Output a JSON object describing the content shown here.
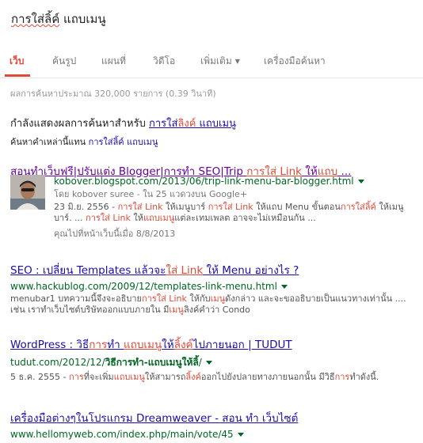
{
  "search": {
    "query_prefix": "การใส่",
    "query_misspelled": "ลิ้ค์",
    "query_suffix": " แถบเมนู"
  },
  "tabs": {
    "web": "เว็บ",
    "images": "ค้นรูป",
    "maps": "แผนที่",
    "videos": "วิดีโอ",
    "more": "เพิ่มเติม",
    "tools": "เครื่องมือค้นหา"
  },
  "stats": "ผลการค้นหาประมาณ 320,000 รายการ (0.39 วินาที)",
  "spelling": {
    "showing_label": "กำลังแสดงผลการค้นหาสำหรับ",
    "corrected_a": "การใส่",
    "corrected_b": "ลิงค์",
    "corrected_c": " แถบเมนู",
    "instead_label": "ค้นหาคำเหล่านี้แทน",
    "instead_query": "การใส่ลิ้ค์ แถบเมนู"
  },
  "results": [
    {
      "title_a": "สอนทำเว็บฟรี|ปรับแต่ง Blogger|การทำ SEO|Trip ",
      "title_em": "การใส่ Link",
      "title_b": " ให้",
      "title_em2": "แถบ",
      "title_c": " ...",
      "url": "kobover.blogspot.com/2013/06/trip-link-menu-bar-blogger.html",
      "author_meta": "โดย kobover suree - ใน 25 แวดวงบน Google+",
      "snippet_date": "23 มิ.ย. 2556 - ",
      "snippet_1": "การใส่ Link",
      "snippet_2": " ให้เมนูบาร์ ",
      "snippet_3": "การใส่ Link",
      "snippet_4": " ให้แถบ Menu ขั้นตอน",
      "snippet_5": "การใส่ลิ้ค์",
      "snippet_6": " ให้เมนูบาร์. ... ",
      "snippet_7": "การใส่ Link",
      "snippet_8": " ให้",
      "snippet_9": "แถบเมนู",
      "snippet_10": "แต่ละเทมเพลต อาจจะไม่เหมือนกัน ...",
      "visited": "คุณไปที่หน้าเว็บนี้เมื่อ 8/8/2013"
    },
    {
      "title_a": "SEO : เปลี่ยน Templates แล้วจะ",
      "title_em": "ใส่ Link",
      "title_b": " ให้ Menu อย่างไร ?",
      "url": "www.hackublog.com/2009/12/templates-link-menu.html",
      "snippet_1": "menubar1 บทความนี้จึงจะอธิบาย",
      "snippet_em1": "การใส่ Link",
      "snippet_2": " ให้กับ",
      "snippet_em2": "เมนู",
      "snippet_3": "ดังกล่าว และจะขออธิบายเป็นแนวทางเท่านั้น .... เช่น เราทำเว็บไซต์บริษัทออกแบบภายใน มี",
      "snippet_em3": "เมนู",
      "snippet_4": "ลิงค์คำว่า Condo"
    },
    {
      "title_a": "WordPress : วิธี",
      "title_em": "การ",
      "title_b": "ทำ ",
      "title_em2": "แถบเมนู",
      "title_c": "ให้",
      "title_em3": "ลิ้งค์",
      "title_d": "ไปภายนอก | TUDUT",
      "url_a": "tudut.com/2012/12/",
      "url_b": "วิธีการทำ-แถบเมนูให้ลิ้",
      "url_c": "/",
      "snippet_date": "5 ธ.ค. 2555 - ",
      "snippet_em1": "การ",
      "snippet_1": "ที่จะเพิ่ม",
      "snippet_em2": "แถบเมนู",
      "snippet_2": "ให้สามารถ",
      "snippet_em3": "ลิ้งค์",
      "snippet_3": "ออกไปยังปลายทางภายนอกนั้น มีวิธี",
      "snippet_em4": "การ",
      "snippet_4": "ทำดังนี้."
    },
    {
      "title": "เครื่องมือต่างๆในโปรแกรม Dreamweaver - สอน ทำ เว็บไซต์",
      "url": "www.hellomyweb.com/index.php/main/vote/45"
    }
  ],
  "colors": {
    "accent": "#dd4b39",
    "link": "#1a0dab",
    "visited_link": "#660099",
    "url_green": "#006621",
    "snippet": "#545454"
  }
}
